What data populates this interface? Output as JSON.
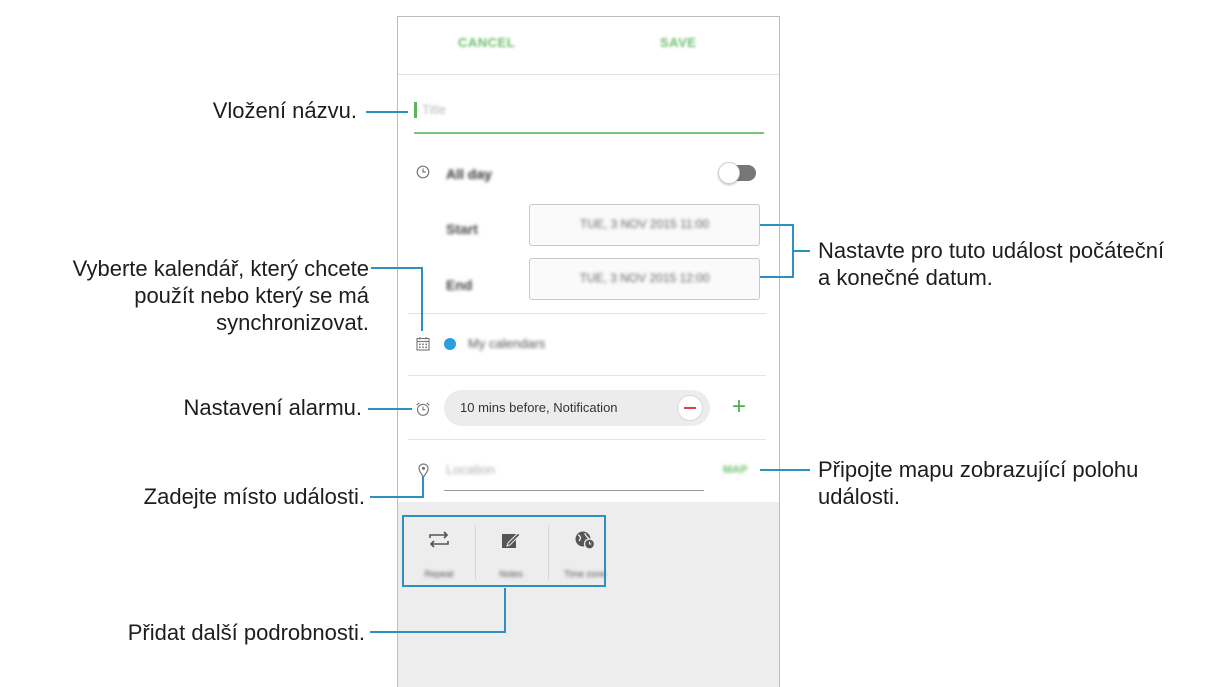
{
  "header": {
    "cancel_label": "CANCEL",
    "save_label": "SAVE"
  },
  "title_field": {
    "placeholder": "Title"
  },
  "all_day": {
    "label": "All day",
    "enabled": false
  },
  "start": {
    "label": "Start",
    "value": "TUE, 3 NOV 2015 11:00"
  },
  "end": {
    "label": "End",
    "value": "TUE, 3 NOV 2015 12:00"
  },
  "calendar": {
    "name": "My calendars",
    "color": "#2aa0e0"
  },
  "alarm": {
    "value": "10 mins before, Notification"
  },
  "location": {
    "placeholder": "Location",
    "map_label": "MAP"
  },
  "options": [
    {
      "label": "Repeat",
      "icon": "repeat-icon"
    },
    {
      "label": "Notes",
      "icon": "notes-icon"
    },
    {
      "label": "Time zone",
      "icon": "time-zone-icon"
    }
  ],
  "annotations": {
    "title": "Vložení názvu.",
    "calendar_line1": "Vyberte kalendář, který chcete",
    "calendar_line2": "použít nebo který se má",
    "calendar_line3": "synchronizovat.",
    "alarm": "Nastavení alarmu.",
    "location": "Zadejte místo události.",
    "details": "Přidat další podrobnosti.",
    "dates_line1": "Nastavte pro tuto událost počáteční",
    "dates_line2": "a konečné datum.",
    "map_line1": "Připojte mapu zobrazující polohu",
    "map_line2": "události."
  },
  "colors": {
    "accent_green": "#6cc06b",
    "callout_line": "#2e8fc0",
    "remove_red": "#e0414a"
  }
}
